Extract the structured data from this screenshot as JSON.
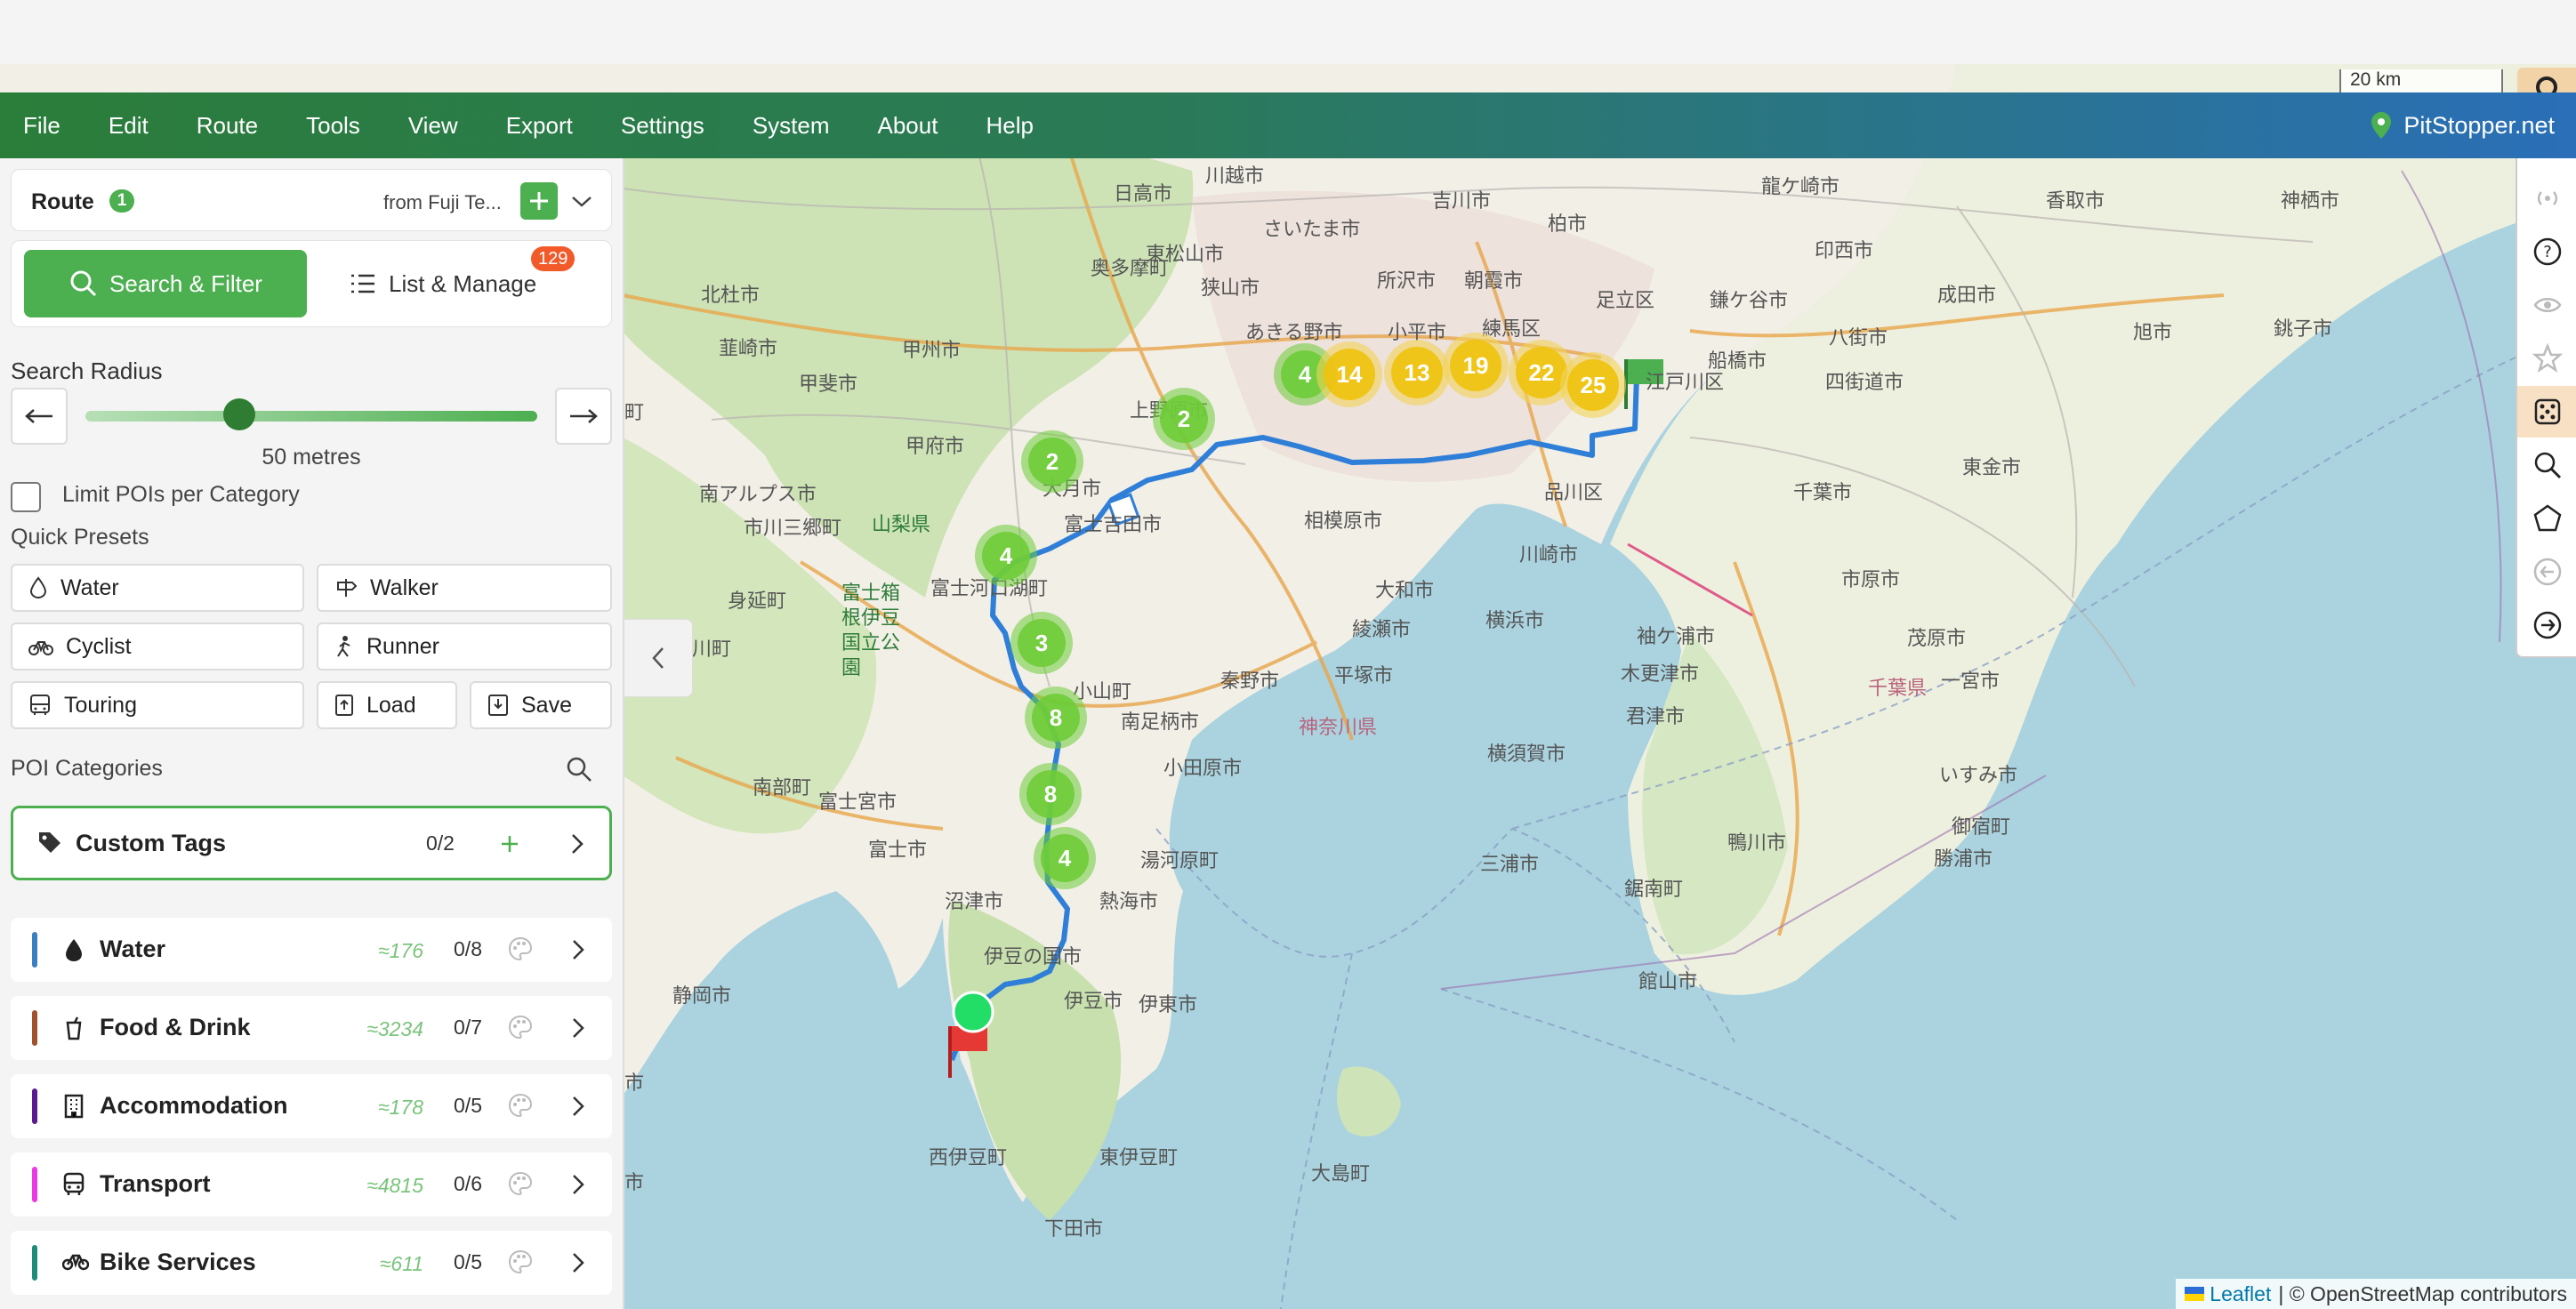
{
  "menu": {
    "items": [
      "File",
      "Edit",
      "Route",
      "Tools",
      "View",
      "Export",
      "Settings",
      "System",
      "About",
      "Help"
    ],
    "brand": "PitStopper.net"
  },
  "map": {
    "scale_label": "20 km",
    "attribution_leaflet": "Leaflet",
    "attribution_rest": "| © OpenStreetMap contributors",
    "clusters_green": [
      "4",
      "2",
      "2",
      "4",
      "3",
      "8",
      "8",
      "4"
    ],
    "clusters_yellow": [
      "14",
      "13",
      "19",
      "22",
      "25"
    ],
    "places": [
      "川越市",
      "吉川市",
      "龍ケ崎市",
      "柏市",
      "香取市",
      "神栖市",
      "日高市",
      "さいたま市",
      "印西市",
      "東松山市",
      "狭山市",
      "所沢市",
      "朝霞市",
      "足立区",
      "江戸川区",
      "鎌ケ谷市",
      "成田市",
      "八街市",
      "旭市",
      "銚子市",
      "奥多摩町",
      "あきる野市",
      "小平市",
      "練馬区",
      "船橋市",
      "四街道市",
      "東金市",
      "北杜市",
      "甲斐市",
      "韮崎市",
      "甲州市",
      "上野原市",
      "甲府市",
      "大月市",
      "相模原市",
      "品川区",
      "千葉市",
      "南アルプス市",
      "市川三郷町",
      "山梨県",
      "富士河口湖町",
      "大和市",
      "川崎市",
      "市原市",
      "身延町",
      "富士箱根伊豆国立公園",
      "富士吉田市",
      "綾瀬市",
      "横浜市",
      "袖ケ浦市",
      "木更津市",
      "茂原市",
      "早川町",
      "秦野市",
      "平塚市",
      "神奈川県",
      "君津市",
      "千葉県",
      "一宮市",
      "小山町",
      "南足柄市",
      "横須賀市",
      "いすみ市",
      "富士宮市",
      "小田原市",
      "御宿町",
      "南部町",
      "富士市",
      "湯河原町",
      "三浦市",
      "鋸南町",
      "鴨川市",
      "勝浦市",
      "沼津市",
      "熱海市",
      "伊豆の国市",
      "静岡市",
      "伊東市",
      "館山市",
      "伊豆市",
      "大島町",
      "西伊豆町",
      "東伊豆町",
      "下田市",
      "市",
      "市",
      "町"
    ]
  },
  "route_card": {
    "label": "Route",
    "badge": "1",
    "from_text": "from Fuji Te..."
  },
  "tabs": {
    "search": "Search & Filter",
    "list": "List & Manage",
    "list_badge": "129"
  },
  "radius": {
    "title": "Search Radius",
    "value_label": "50 metres",
    "level": 0.34
  },
  "limit_label": "Limit POIs per Category",
  "presets": {
    "title": "Quick Presets",
    "water": "Water",
    "walker": "Walker",
    "cyclist": "Cyclist",
    "runner": "Runner",
    "touring": "Touring",
    "load": "Load",
    "save": "Save"
  },
  "poi": {
    "title": "POI Categories",
    "custom_tags": "Custom Tags",
    "custom_frac": "0/2",
    "categories": [
      {
        "name": "Water",
        "count": "≈176",
        "frac": "0/8",
        "color": "#3a7fc1"
      },
      {
        "name": "Food & Drink",
        "count": "≈3234",
        "frac": "0/7",
        "color": "#a0522d"
      },
      {
        "name": "Accommodation",
        "count": "≈178",
        "frac": "0/5",
        "color": "#5b1a8e"
      },
      {
        "name": "Transport",
        "count": "≈4815",
        "frac": "0/6",
        "color": "#e83be0"
      },
      {
        "name": "Bike Services",
        "count": "≈611",
        "frac": "0/5",
        "color": "#1e8c78"
      }
    ]
  },
  "colors": {
    "accent_green": "#4caf50",
    "badge_orange": "#f25a2a",
    "route_blue": "#2f7fd8"
  }
}
